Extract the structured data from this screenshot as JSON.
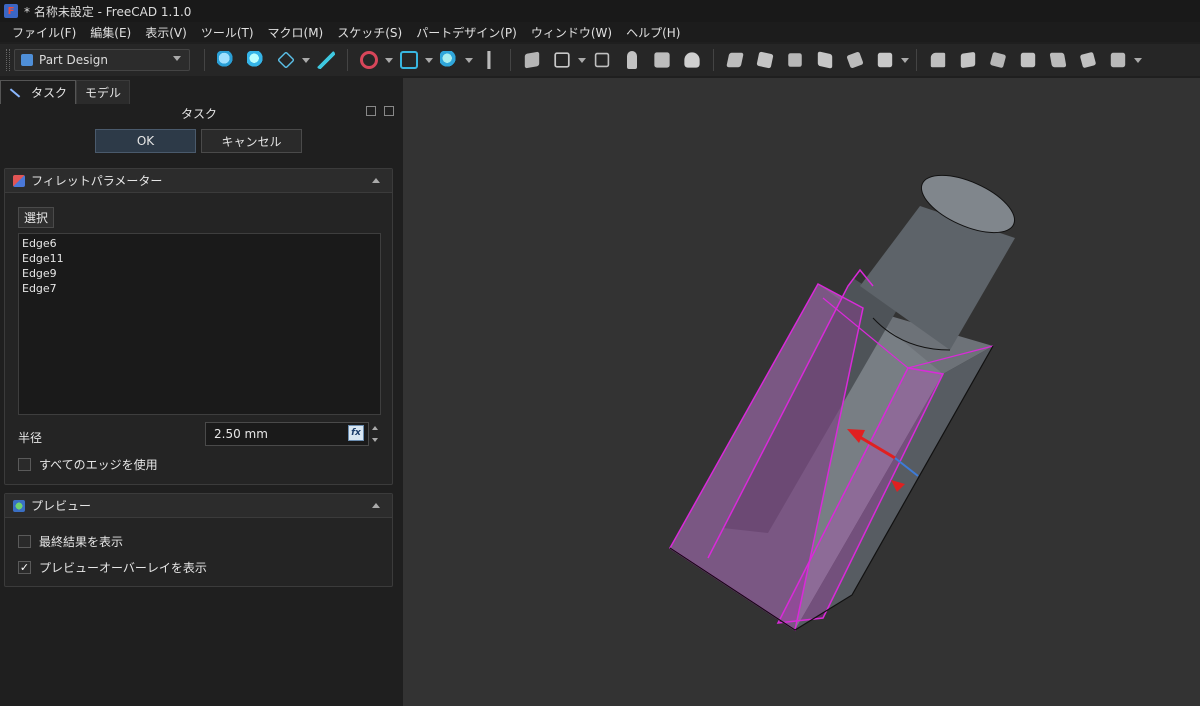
{
  "window": {
    "title": "* 名称未設定 - FreeCAD 1.1.0"
  },
  "menu": {
    "items": [
      "ファイル(F)",
      "編集(E)",
      "表示(V)",
      "ツール(T)",
      "マクロ(M)",
      "スケッチ(S)",
      "パートデザイン(P)",
      "ウィンドウ(W)",
      "ヘルプ(H)"
    ]
  },
  "toolbar": {
    "workbench": "Part Design"
  },
  "tabs": {
    "task": "タスク",
    "model": "モデル"
  },
  "task": {
    "header": "タスク",
    "ok": "OK",
    "cancel": "キャンセル"
  },
  "fillet": {
    "title": "フィレットパラメーター",
    "select_button": "選択",
    "edges": [
      "Edge6",
      "Edge11",
      "Edge9",
      "Edge7"
    ],
    "radius_label": "半径",
    "radius_value": "2.50 mm",
    "fx_label": "fx",
    "use_all_edges_label": "すべてのエッジを使用",
    "use_all_edges_checked": false
  },
  "preview": {
    "title": "プレビュー",
    "show_final_label": "最終結果を表示",
    "show_final_checked": false,
    "show_overlay_label": "プレビューオーバーレイを表示",
    "show_overlay_checked": true,
    "checkmark": "✓"
  },
  "colors": {
    "highlight": "#d92ad9",
    "axis_x": "#e02020",
    "axis_z": "#3d7bd8",
    "body": "#646a70"
  }
}
